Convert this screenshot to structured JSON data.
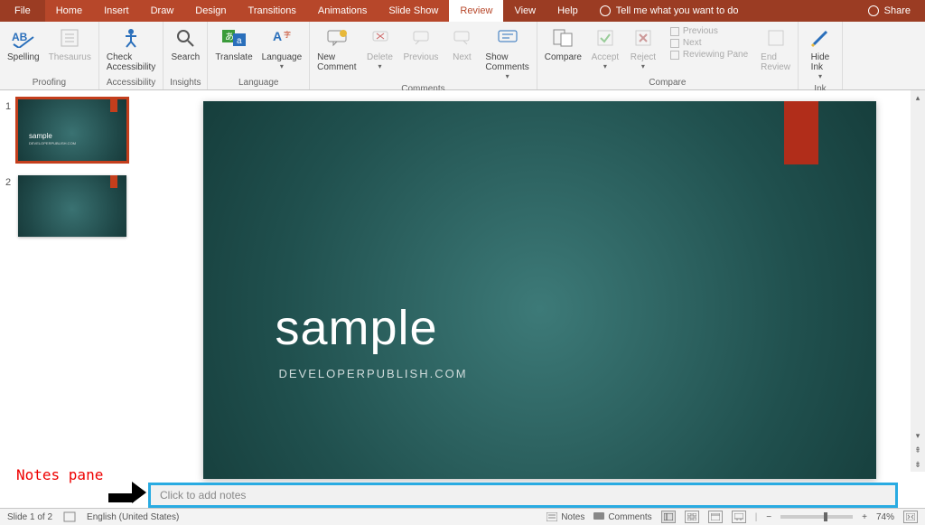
{
  "tabs": {
    "file": "File",
    "home": "Home",
    "insert": "Insert",
    "draw": "Draw",
    "design": "Design",
    "transitions": "Transitions",
    "animations": "Animations",
    "slideshow": "Slide Show",
    "review": "Review",
    "view": "View",
    "help": "Help"
  },
  "tellme": "Tell me what you want to do",
  "share": "Share",
  "ribbon": {
    "spelling": "Spelling",
    "thesaurus": "Thesaurus",
    "proofing": "Proofing",
    "check_access": "Check\nAccessibility",
    "accessibility": "Accessibility",
    "search": "Search",
    "insights": "Insights",
    "translate": "Translate",
    "language": "Language",
    "language_grp": "Language",
    "new_comment": "New\nComment",
    "delete": "Delete",
    "previous": "Previous",
    "next": "Next",
    "show_comments": "Show\nComments",
    "comments_grp": "Comments",
    "compare": "Compare",
    "accept": "Accept",
    "reject": "Reject",
    "prev_change": "Previous",
    "next_change": "Next",
    "reviewing_pane": "Reviewing Pane",
    "end_review": "End\nReview",
    "compare_grp": "Compare",
    "hide_ink": "Hide\nInk",
    "ink_grp": "Ink"
  },
  "thumbs": {
    "n1": "1",
    "n2": "2",
    "title": "sample"
  },
  "slide": {
    "title": "sample",
    "subtitle": "DEVELOPERPUBLISH.COM"
  },
  "annotation": {
    "label": "Notes pane"
  },
  "notes_placeholder": "Click to add notes",
  "status": {
    "slide": "Slide 1 of 2",
    "lang": "English (United States)",
    "notes": "Notes",
    "comments": "Comments",
    "zoom": "74%",
    "minus": "−",
    "plus": "+"
  }
}
